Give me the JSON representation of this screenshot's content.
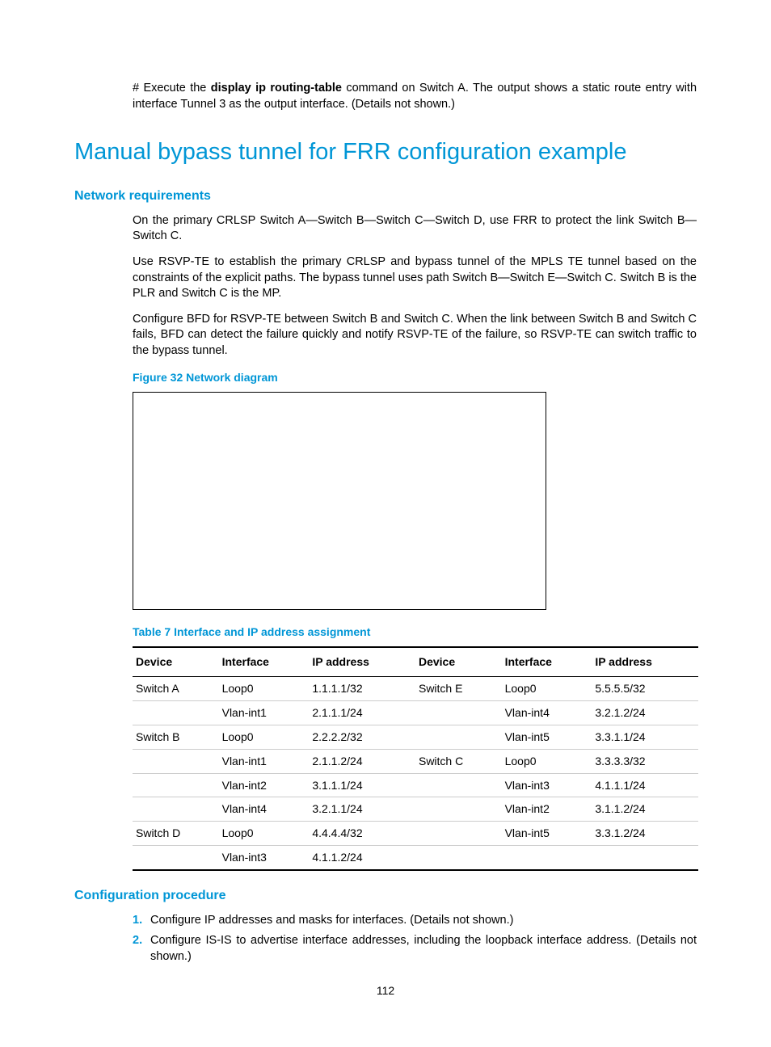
{
  "intro_para_prefix": "# Execute the ",
  "intro_para_bold": "display ip routing-table",
  "intro_para_suffix": " command on Switch A. The output shows a static route entry with interface Tunnel 3 as the output interface. (Details not shown.)",
  "section_title": "Manual bypass tunnel for FRR configuration example",
  "network_req_heading": "Network requirements",
  "network_req_p1": "On the primary CRLSP Switch A—Switch B—Switch C—Switch D, use FRR to protect the link Switch B—Switch C.",
  "network_req_p2": "Use RSVP-TE to establish the primary CRLSP and bypass tunnel of the MPLS TE tunnel based on the constraints of the explicit paths. The bypass tunnel uses path Switch B—Switch E—Switch C. Switch B is the PLR and Switch C is the MP.",
  "network_req_p3": "Configure BFD for RSVP-TE between Switch B and Switch C. When the link between Switch B and Switch C fails, BFD can detect the failure quickly and notify RSVP-TE of the failure, so RSVP-TE can switch traffic to the bypass tunnel.",
  "figure_caption": "Figure 32 Network diagram",
  "table_caption": "Table 7 Interface and IP address assignment",
  "table_headers": {
    "device": "Device",
    "interface": "Interface",
    "ip": "IP address",
    "device2": "Device",
    "interface2": "Interface",
    "ip2": "IP address"
  },
  "table_rows": [
    {
      "d1": "Switch A",
      "i1": "Loop0",
      "a1": "1.1.1.1/32",
      "d2": "Switch E",
      "i2": "Loop0",
      "a2": "5.5.5.5/32"
    },
    {
      "d1": "",
      "i1": "Vlan-int1",
      "a1": "2.1.1.1/24",
      "d2": "",
      "i2": "Vlan-int4",
      "a2": "3.2.1.2/24"
    },
    {
      "d1": "Switch B",
      "i1": "Loop0",
      "a1": "2.2.2.2/32",
      "d2": "",
      "i2": "Vlan-int5",
      "a2": "3.3.1.1/24"
    },
    {
      "d1": "",
      "i1": "Vlan-int1",
      "a1": "2.1.1.2/24",
      "d2": "Switch C",
      "i2": "Loop0",
      "a2": "3.3.3.3/32"
    },
    {
      "d1": "",
      "i1": "Vlan-int2",
      "a1": "3.1.1.1/24",
      "d2": "",
      "i2": "Vlan-int3",
      "a2": "4.1.1.1/24"
    },
    {
      "d1": "",
      "i1": "Vlan-int4",
      "a1": "3.2.1.1/24",
      "d2": "",
      "i2": "Vlan-int2",
      "a2": "3.1.1.2/24"
    },
    {
      "d1": "Switch D",
      "i1": "Loop0",
      "a1": "4.4.4.4/32",
      "d2": "",
      "i2": "Vlan-int5",
      "a2": "3.3.1.2/24"
    },
    {
      "d1": "",
      "i1": "Vlan-int3",
      "a1": "4.1.1.2/24",
      "d2": "",
      "i2": "",
      "a2": ""
    }
  ],
  "config_proc_heading": "Configuration procedure",
  "steps": [
    {
      "num": "1.",
      "text": "Configure IP addresses and masks for interfaces. (Details not shown.)"
    },
    {
      "num": "2.",
      "text": "Configure IS-IS to advertise interface addresses, including the loopback interface address. (Details not shown.)"
    }
  ],
  "page_number": "112"
}
